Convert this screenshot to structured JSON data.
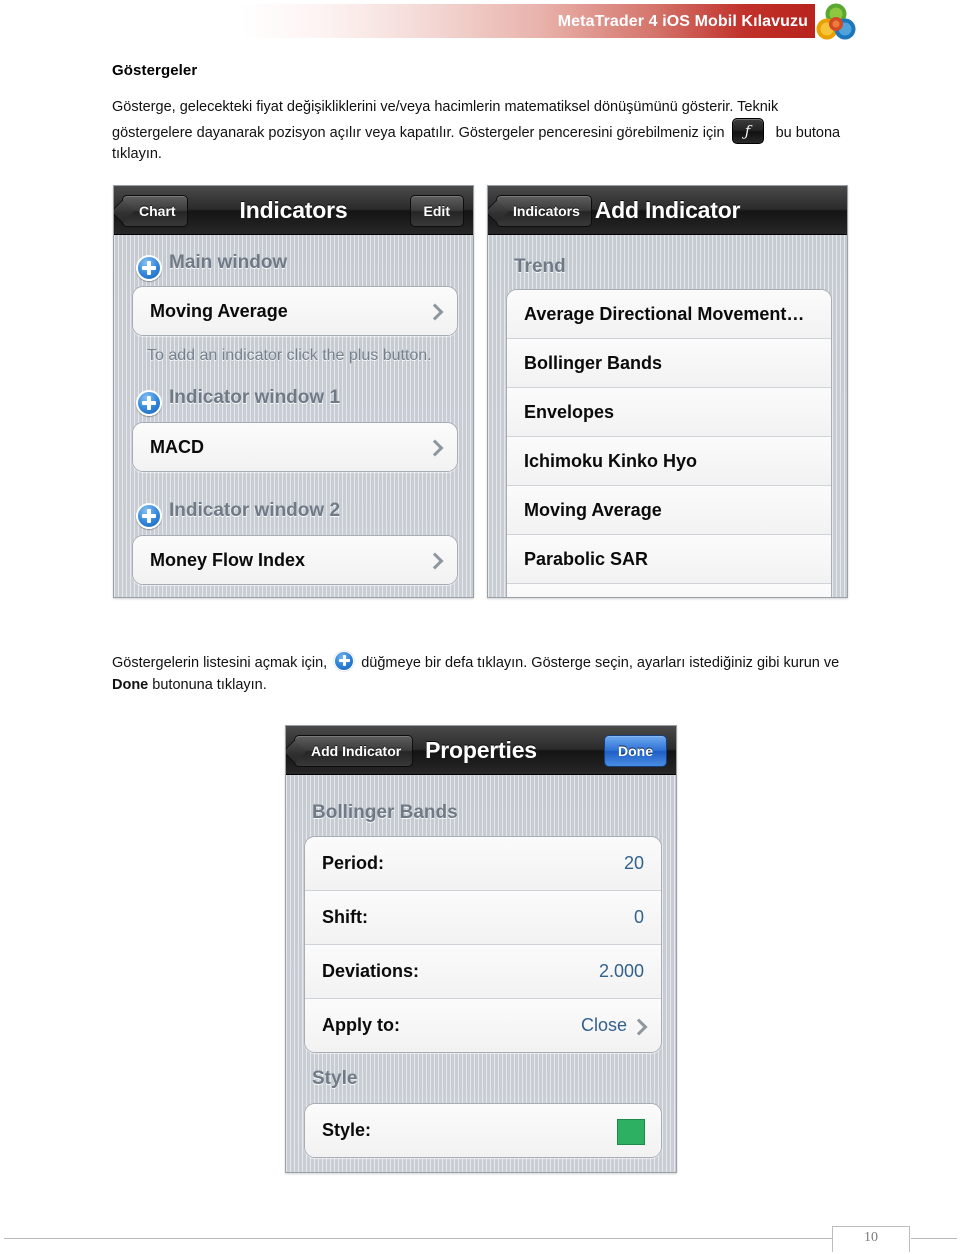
{
  "banner": {
    "title": "MetaTrader 4 iOS Mobil Kılavuzu",
    "logo_icon": "metaquotes-logo-icon",
    "accent_color": "#b8231d"
  },
  "document": {
    "section_title": "Göstergeler",
    "paragraph1_part1": "Gösterge, gelecekteki fiyat değişikliklerini ve/veya hacimlerin matematiksel dönüşümünü gösterir. Teknik göstergelere dayanarak pozisyon açılır veya kapatılır. Göstergeler penceresini görebilmeniz için",
    "indicator_button_glyph": "ƒ",
    "paragraph1_part2": "bu butona tıklayın.",
    "paragraph2_part1": "Göstergelerin listesini açmak için,",
    "paragraph2_part2": "düğmeye bir defa tıklayın. Gösterge seçin, ayarları istediğiniz gibi kurun ve",
    "paragraph2_bold": "Done",
    "paragraph2_part3": "butonuna tıklayın."
  },
  "screen_indicators": {
    "back_button": "Chart",
    "title": "Indicators",
    "edit_button": "Edit",
    "groups": [
      {
        "label": "Main window",
        "plus_icon": "add-circle-icon",
        "rows": [
          {
            "label": "Moving Average",
            "accessory": "chevron-right-icon"
          }
        ],
        "hint": "To add an indicator click the plus button."
      },
      {
        "label": "Indicator window 1",
        "plus_icon": "add-circle-icon",
        "rows": [
          {
            "label": "MACD",
            "accessory": "chevron-right-icon"
          }
        ],
        "hint": ""
      },
      {
        "label": "Indicator window 2",
        "plus_icon": "add-circle-icon",
        "rows": [
          {
            "label": "Money Flow Index",
            "accessory": "chevron-right-icon"
          }
        ],
        "hint": ""
      }
    ]
  },
  "screen_add_indicator": {
    "back_button": "Indicators",
    "title": "Add Indicator",
    "section_label": "Trend",
    "rows": [
      {
        "label": "Average Directional Movement…"
      },
      {
        "label": "Bollinger Bands"
      },
      {
        "label": "Envelopes"
      },
      {
        "label": "Ichimoku Kinko Hyo"
      },
      {
        "label": "Moving Average"
      },
      {
        "label": "Parabolic SAR"
      }
    ]
  },
  "screen_properties": {
    "back_button": "Add Indicator",
    "title": "Properties",
    "done_button": "Done",
    "section_label": "Bollinger Bands",
    "rows": [
      {
        "label": "Period:",
        "value": "20",
        "accessory": "none"
      },
      {
        "label": "Shift:",
        "value": "0",
        "accessory": "none"
      },
      {
        "label": "Deviations:",
        "value": "2.000",
        "accessory": "none"
      },
      {
        "label": "Apply to:",
        "value": "Close",
        "accessory": "chevron-right-icon"
      }
    ],
    "style_section_label": "Style",
    "style_row": {
      "label": "Style:",
      "swatch_color": "#2eb062"
    }
  },
  "footer": {
    "page_number": "10"
  }
}
